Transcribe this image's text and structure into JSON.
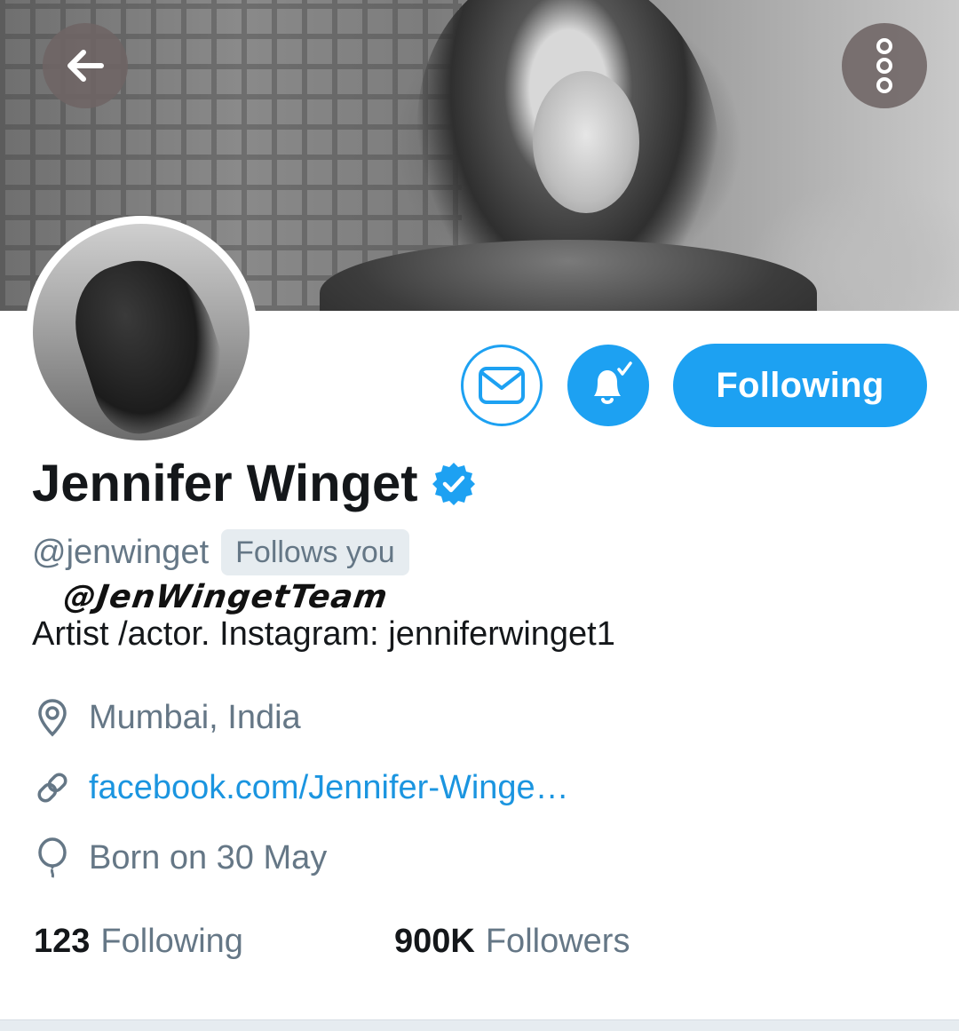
{
  "header": {
    "back_icon": "arrow-left-icon",
    "more_icon": "vertical-dots-icon"
  },
  "actions": {
    "dm_icon": "envelope-icon",
    "notifications_icon": "bell-check-icon",
    "follow_label": "Following"
  },
  "profile": {
    "name": "Jennifer Winget",
    "verified_icon": "verified-badge-icon",
    "handle": "@jenwinget",
    "follows_you_label": "Follows you",
    "watermark": "@JenWingetTeam",
    "bio": "Artist /actor. Instagram: jenniferwinget1",
    "location": "Mumbai, India",
    "website": "facebook.com/Jennifer-Winge…",
    "birthday": "Born on 30 May"
  },
  "stats": {
    "following_count": "123",
    "following_label": "Following",
    "followers_count": "900K",
    "followers_label": "Followers"
  },
  "colors": {
    "accent": "#1da1f2",
    "link": "#1b95e0",
    "secondary_text": "#657786",
    "primary_text": "#14171a"
  }
}
